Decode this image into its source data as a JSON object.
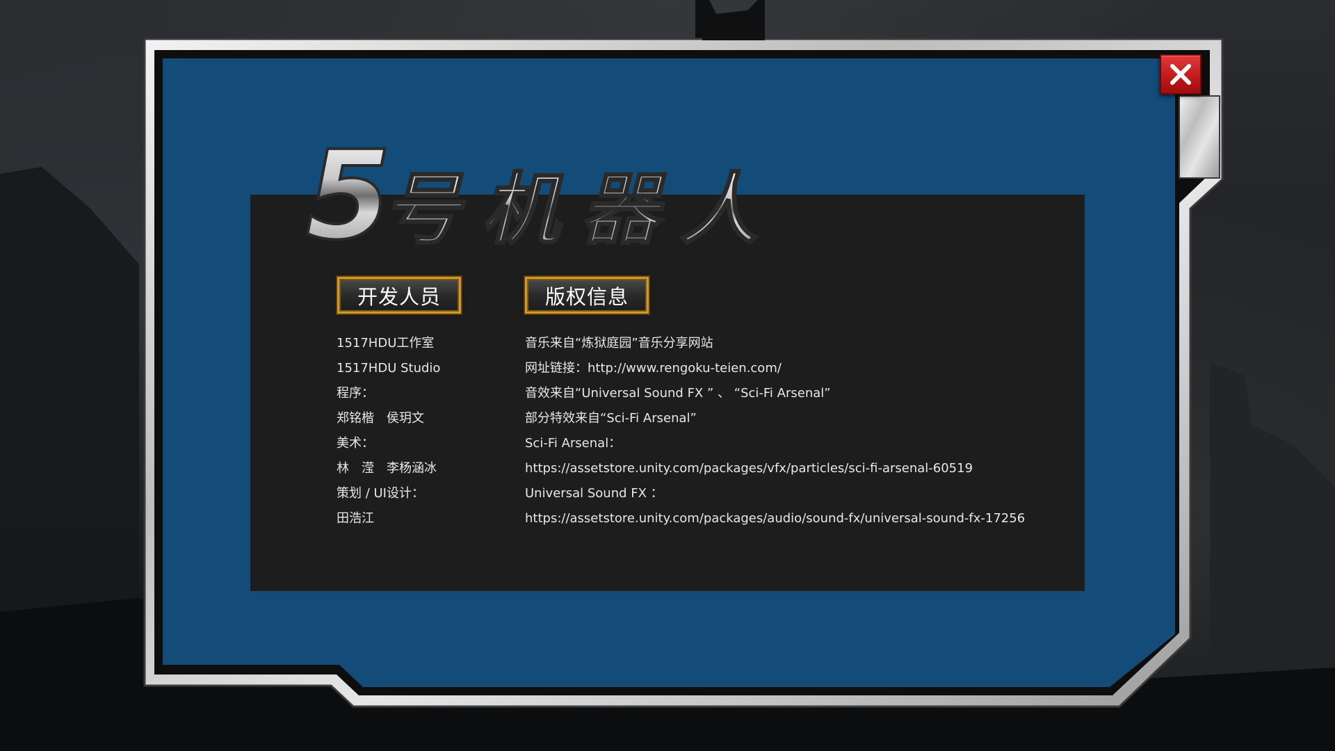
{
  "game": {
    "logo_text": "5号机器人"
  },
  "tabs": {
    "developers_label": "开发人员",
    "copyright_label": "版权信息"
  },
  "developers": [
    "1517HDU工作室",
    "1517HDU Studio",
    "程序：",
    "郑铭楷　侯玥文",
    "美术：",
    "林　滢　李杨涵冰",
    "策划 / UI设计：",
    "田浩江"
  ],
  "copyright": [
    "音乐来自“炼狱庭园”音乐分享网站",
    "网址链接：http://www.rengoku-teien.com/",
    "音效来自“Universal Sound FX ” 、 “Sci-Fi Arsenal”",
    "部分特效来自“Sci-Fi Arsenal”",
    "Sci-Fi Arsenal：",
    "https://assetstore.unity.com/packages/vfx/particles/sci-fi-arsenal-60519",
    "Universal Sound FX ：",
    "https://assetstore.unity.com/packages/audio/sound-fx/universal-sound-fx-17256"
  ],
  "colors": {
    "panel_blue": "#134c79",
    "content_dark": "#1d1d1e",
    "button_border_gold": "#d29a23",
    "close_red": "#c8191b"
  },
  "icons": {
    "close": "close-x-icon"
  }
}
